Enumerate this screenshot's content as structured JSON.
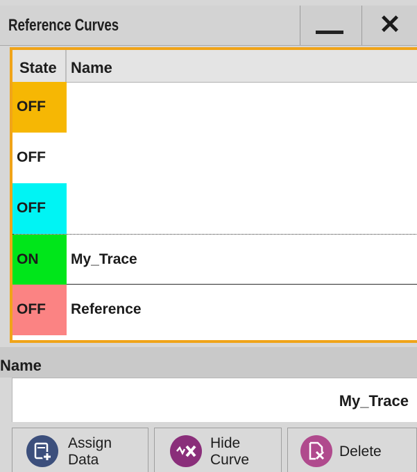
{
  "window": {
    "title": "Reference Curves"
  },
  "table": {
    "headers": {
      "state": "State",
      "name": "Name"
    },
    "rows": [
      {
        "state": "OFF",
        "name": "",
        "color": "#f6b704"
      },
      {
        "state": "OFF",
        "name": "",
        "color": "#ffffff"
      },
      {
        "state": "OFF",
        "name": "",
        "color": "#00f4f4"
      },
      {
        "state": "ON",
        "name": "My_Trace",
        "color": "#00e61a",
        "selected": true
      },
      {
        "state": "OFF",
        "name": "Reference",
        "color": "#fb8383"
      }
    ]
  },
  "name_section": {
    "label": "Name",
    "value": "My_Trace"
  },
  "buttons": {
    "assign": {
      "line1": "Assign",
      "line2": "Data",
      "icon": "assign-data-icon"
    },
    "hide": {
      "line1": "Hide",
      "line2": "Curve",
      "icon": "hide-curve-icon"
    },
    "delete": {
      "label": "Delete",
      "icon": "delete-icon"
    }
  },
  "colors": {
    "highlight": "#f0a419"
  }
}
